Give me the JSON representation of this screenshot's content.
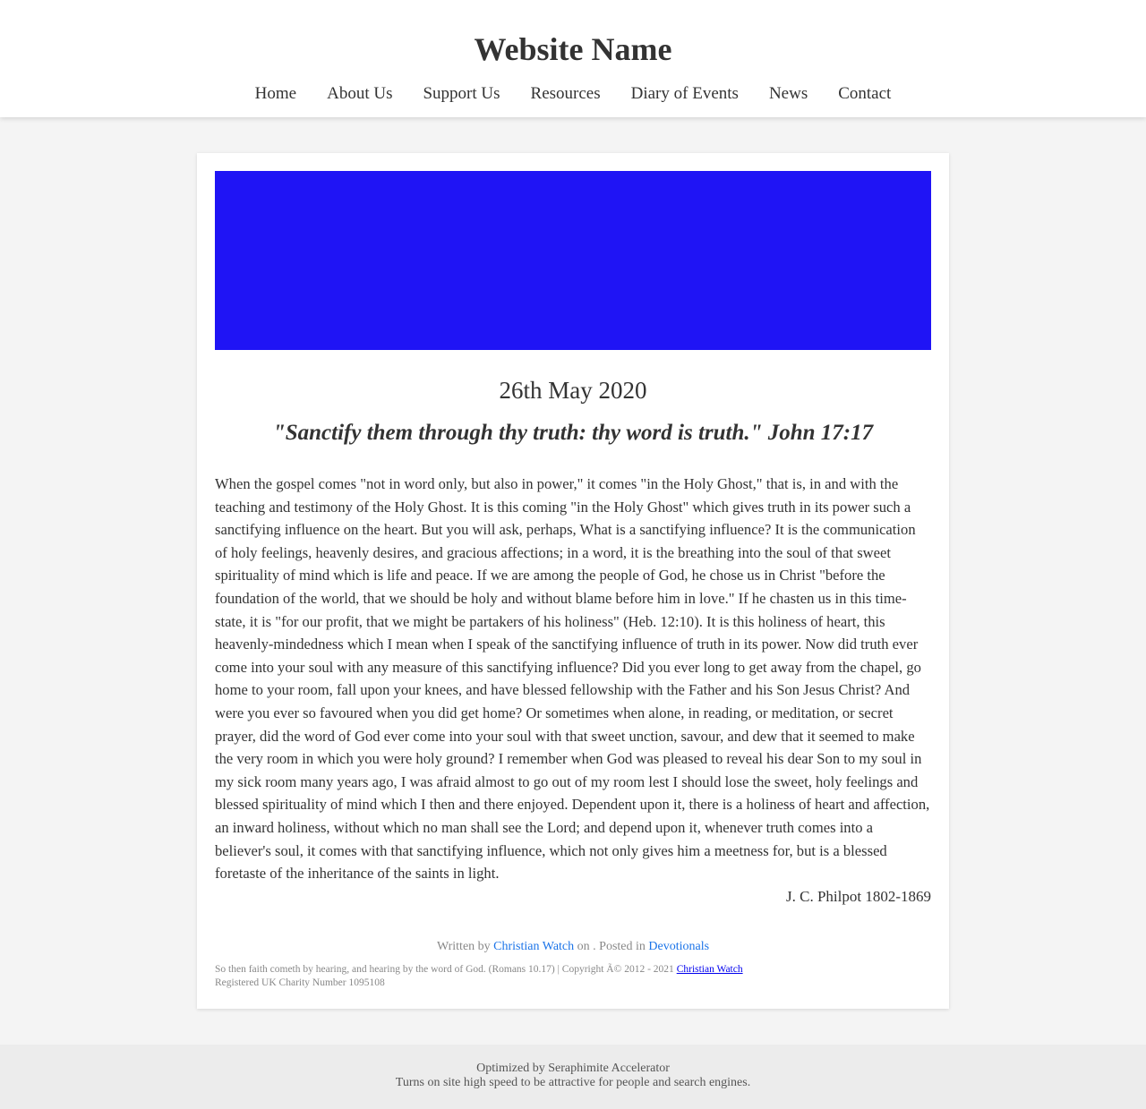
{
  "header": {
    "site_title": "Website Name",
    "nav": [
      "Home",
      "About Us",
      "Support Us",
      "Resources",
      "Diary of Events",
      "News",
      "Contact"
    ]
  },
  "post": {
    "banner_color": "#1f14f5",
    "date": "26th May 2020",
    "title": "\"Sanctify them through thy truth: thy word is truth.\" John 17:17",
    "body": "When the gospel comes \"not in word only, but also in power,\" it comes \"in the Holy Ghost,\" that is, in and with the teaching and testimony of the Holy Ghost. It is this coming \"in the Holy Ghost\" which gives truth in its power such a sanctifying influence on the heart. But you will ask, perhaps, What is a sanctifying influence? It is the communication of holy feelings, heavenly desires, and gracious affections; in a word, it is the breathing into the soul of that sweet spirituality of mind which is life and peace. If we are among the people of God, he chose us in Christ \"before the foundation of the world, that we should be holy and without blame before him in love.\" If he chasten us in this time-state, it is \"for our profit, that we might be partakers of his holiness\" (Heb. 12:10). It is this holiness of heart, this heavenly-mindedness which I mean when I speak of the sanctifying influence of truth in its power. Now did truth ever come into your soul with any measure of this sanctifying influence? Did you ever long to get away from the chapel, go home to your room, fall upon your knees, and have blessed fellowship with the Father and his Son Jesus Christ? And were you ever so favoured when you did get home? Or sometimes when alone, in reading, or meditation, or secret prayer, did the word of God ever come into your soul with that sweet unction, savour, and dew that it seemed to make the very room in which you were holy ground? I remember when God was pleased to reveal his dear Son to my soul in my sick room many years ago, I was afraid almost to go out of my room lest I should lose the sweet, holy feelings and blessed spirituality of mind which I then and there enjoyed. Dependent upon it, there is a holiness of heart and affection, an inward holiness, without which no man shall see the Lord; and depend upon it, whenever truth comes into a believer's soul, it comes with that sanctifying influence, which not only gives him a meetness for, but is a blessed foretaste of the inheritance of the saints in light.",
    "author": "J. C. Philpot 1802-1869"
  },
  "meta": {
    "written_by_prefix": "Written by",
    "author_link": "Christian Watch",
    "on_text": "on . Posted in",
    "category_link": "Devotionals"
  },
  "footer_note": {
    "verse_text": "So then faith cometh by hearing, and hearing by the word of God. (Romans 10.17) | Copyright Ã© 2012 - 2021",
    "link": "Christian Watch",
    "charity": "Registered UK Charity Number 1095108"
  },
  "site_footer": {
    "line1": "Optimized by Seraphimite Accelerator",
    "line2": "Turns on site high speed to be attractive for people and search engines."
  }
}
